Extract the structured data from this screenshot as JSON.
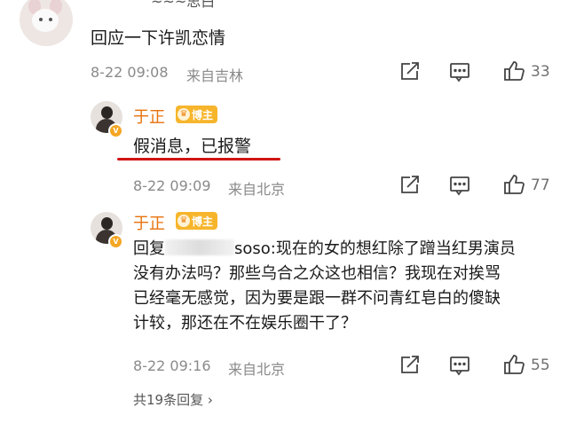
{
  "comments": [
    {
      "partial_name": "~~~思白",
      "text": "回应一下许凯恋情",
      "date": "8-22 09:08",
      "location": "来自吉林",
      "likes": "33"
    },
    {
      "user": "于正",
      "badge": "博主",
      "text": "假消息，已报警",
      "date": "8-22 09:09",
      "location": "来自北京",
      "likes": "77"
    },
    {
      "user": "于正",
      "badge": "博主",
      "reply_prefix": "回复",
      "reply_suffix": "soso:现在的女的想红除了蹭当红男演员",
      "reply_lines": [
        "没有办法吗？那些乌合之众这也相信？我现在对挨骂",
        "已经毫无感觉，因为要是跟一群不问青红皂白的傻缺",
        "计较，那还在不在娱乐圈干了？"
      ],
      "date": "8-22 09:16",
      "location": "来自北京",
      "likes": "55"
    }
  ],
  "more_replies": "共19条回复 ›",
  "icons": [
    "share-icon",
    "comment-icon",
    "like-icon"
  ],
  "colors": {
    "username": "#e8720c",
    "underline": "#d01414",
    "badge": "#f7b52c"
  }
}
